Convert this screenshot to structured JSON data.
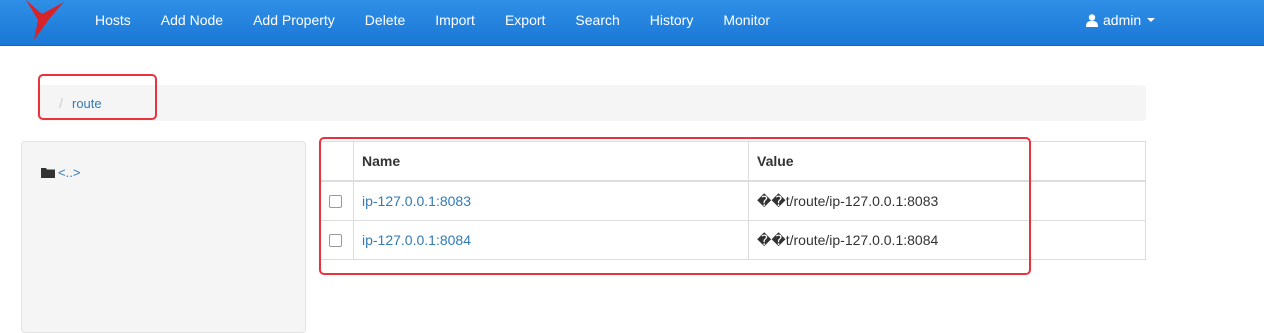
{
  "navbar": {
    "items": [
      "Hosts",
      "Add Node",
      "Add Property",
      "Delete",
      "Import",
      "Export",
      "Search",
      "History",
      "Monitor"
    ],
    "user": "admin"
  },
  "breadcrumb": {
    "separator": "/",
    "current": "route"
  },
  "sidebar": {
    "parent_link": "<..>"
  },
  "table": {
    "headers": {
      "name": "Name",
      "value": "Value"
    },
    "rows": [
      {
        "name": "ip-127.0.0.1:8083",
        "value": "��t/route/ip-127.0.0.1:8083",
        "checked": false
      },
      {
        "name": "ip-127.0.0.1:8084",
        "value": "��t/route/ip-127.0.0.1:8084",
        "checked": false
      }
    ]
  },
  "colors": {
    "navbar": "#1a78d6",
    "link": "#337ab7",
    "highlight": "#e8323c",
    "logo": "#d8232a"
  },
  "icons": [
    "bird-logo",
    "user-icon",
    "folder-icon",
    "caret-down-icon"
  ]
}
